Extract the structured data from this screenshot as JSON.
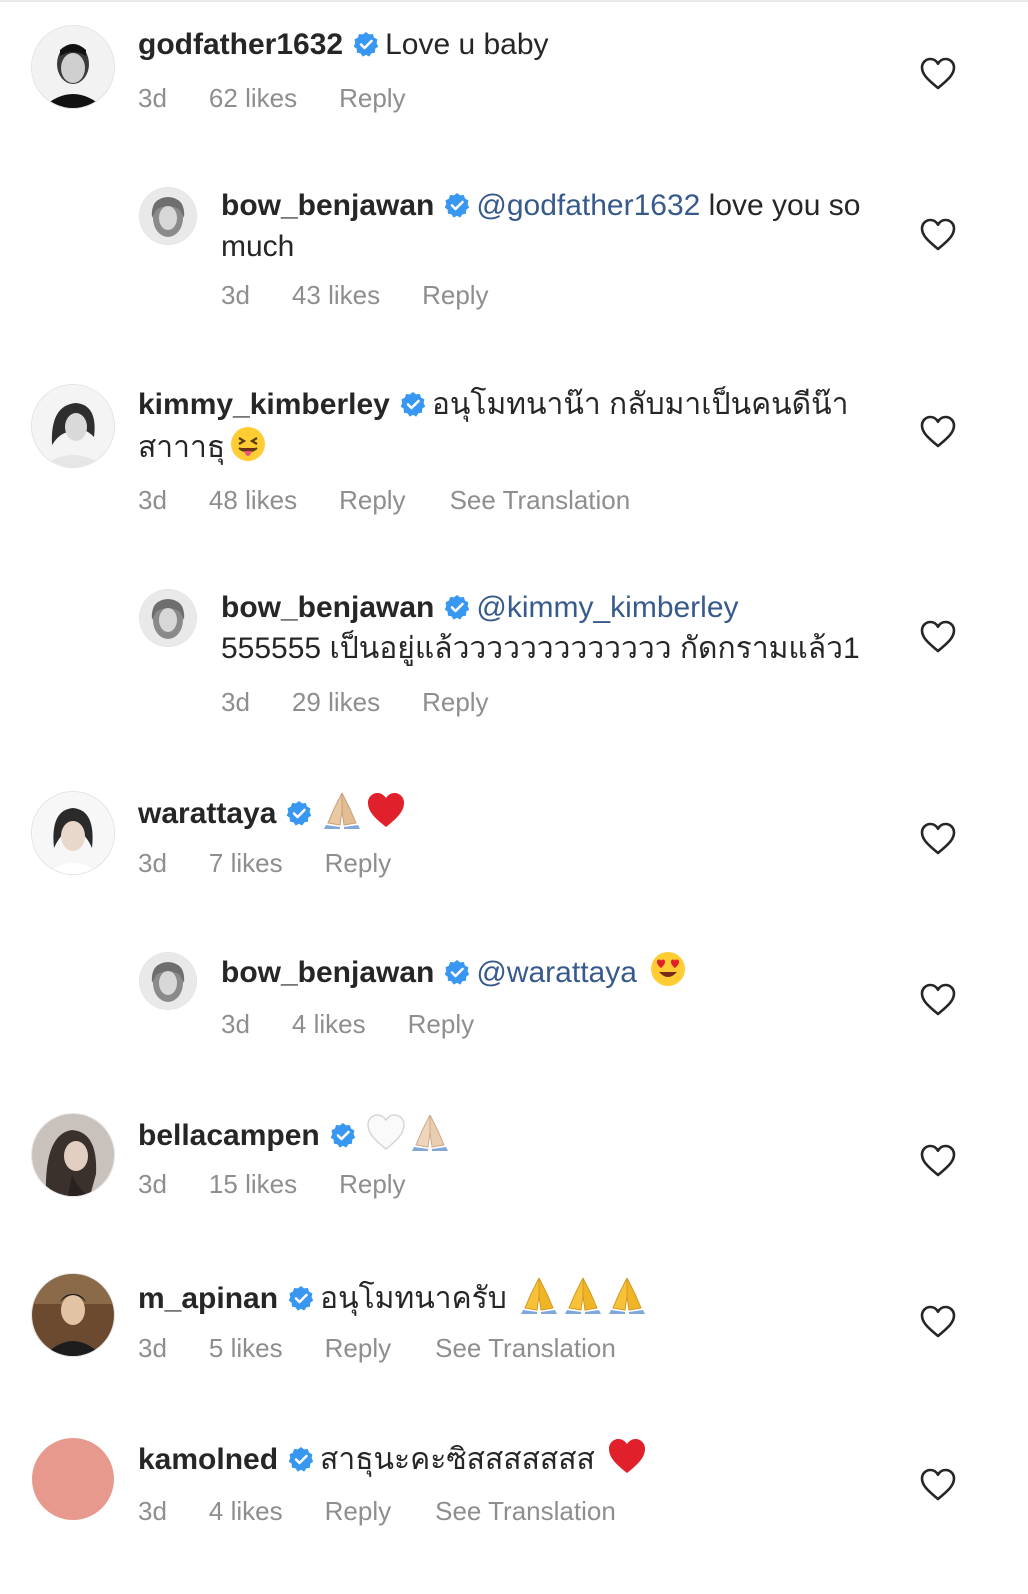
{
  "labels": {
    "reply": "Reply",
    "see_translation": "See Translation"
  },
  "comments": [
    {
      "username": "godfather1632",
      "text": "Love u baby",
      "time": "3d",
      "likes": "62 likes"
    },
    {
      "username": "bow_benjawan",
      "mention": "@godfather1632",
      "text": " love you so much",
      "time": "3d",
      "likes": "43 likes"
    },
    {
      "username": "kimmy_kimberley",
      "text": "อนุโมทนาน๊า กลับมาเป็นคนดีน๊า สาาาธุ",
      "time": "3d",
      "likes": "48 likes"
    },
    {
      "username": "bow_benjawan",
      "mention": "@kimmy_kimberley",
      "text": "555555 เป็นอยู่แล้ววววววววววววว กัดกรามแล้ว1",
      "time": "3d",
      "likes": "29 likes"
    },
    {
      "username": "warattaya",
      "text": "",
      "time": "3d",
      "likes": "7 likes"
    },
    {
      "username": "bow_benjawan",
      "mention": "@warattaya",
      "text": "",
      "time": "3d",
      "likes": "4 likes"
    },
    {
      "username": "bellacampen",
      "text": "",
      "time": "3d",
      "likes": "15 likes"
    },
    {
      "username": "m_apinan",
      "text": "อนุโมทนาครับ",
      "time": "3d",
      "likes": "5 likes"
    },
    {
      "username": "kamolned",
      "text": "สาธุนะคะซิสสสสสสส",
      "time": "3d",
      "likes": "4 likes"
    }
  ],
  "icons": {
    "verified_badge": "verified-badge-icon",
    "like": "heart-outline-icon",
    "emoji_squint_tongue": "squinting-face-with-tongue-emoji",
    "emoji_pray": "folded-hands-emoji",
    "emoji_red_heart": "red-heart-emoji",
    "emoji_white_heart": "white-heart-emoji",
    "emoji_heart_eyes": "smiling-face-with-heart-eyes-emoji"
  },
  "colors": {
    "text": "#262626",
    "meta": "#8e8e8e",
    "mention": "#375a8c",
    "verified": "#3897f0",
    "kamolned_avatar": "#e8998e"
  }
}
